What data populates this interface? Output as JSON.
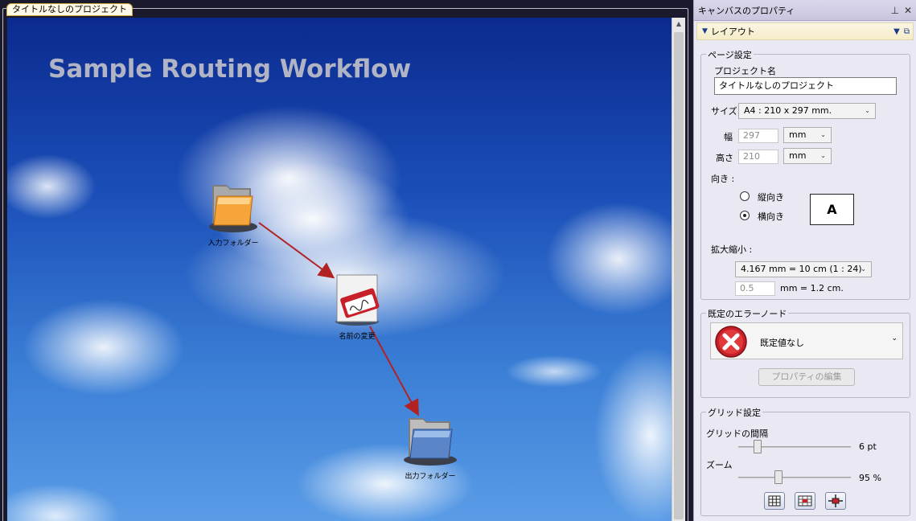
{
  "document": {
    "tab_label": "タイトルなしのプロジェクト",
    "canvas_title": "Sample Routing Workflow",
    "nodes": [
      {
        "label": "入力フォルダー"
      },
      {
        "label": "名前の変更"
      },
      {
        "label": "出力フォルダー"
      }
    ]
  },
  "panel": {
    "title": "キャンバスのプロパティ",
    "pin_icon": "pin-icon",
    "close_icon": "close-icon",
    "section": "レイアウト",
    "page_settings": {
      "group_title": "ページ設定",
      "project_name_label": "プロジェクト名",
      "project_name_value": "タイトルなしのプロジェクト",
      "size_label": "サイズ",
      "size_value": "A4 :   210 x 297 mm.",
      "width_label": "幅",
      "width_value": "297",
      "width_unit": "mm",
      "height_label": "高さ",
      "height_value": "210",
      "height_unit": "mm",
      "orientation_label": "向き :",
      "portrait_label": "縦向き",
      "landscape_label": "横向き",
      "orientation_selected": "landscape",
      "orientation_preview": "A",
      "scale_label": "拡大縮小 :",
      "scale_value": "4.167 mm = 10 cm (1 : 24)",
      "scale_input": "0.5",
      "scale_unit_text": "mm  =  1.2 cm."
    },
    "error_node": {
      "group_title": "既定のエラーノード",
      "value": "既定値なし",
      "edit_button": "プロパティの編集"
    },
    "grid": {
      "group_title": "グリッド設定",
      "spacing_label": "グリッドの間隔",
      "spacing_value": "6 pt",
      "spacing_level": 0.1,
      "zoom_label": "ズーム",
      "zoom_value": "95 %",
      "zoom_level": 0.35
    }
  }
}
